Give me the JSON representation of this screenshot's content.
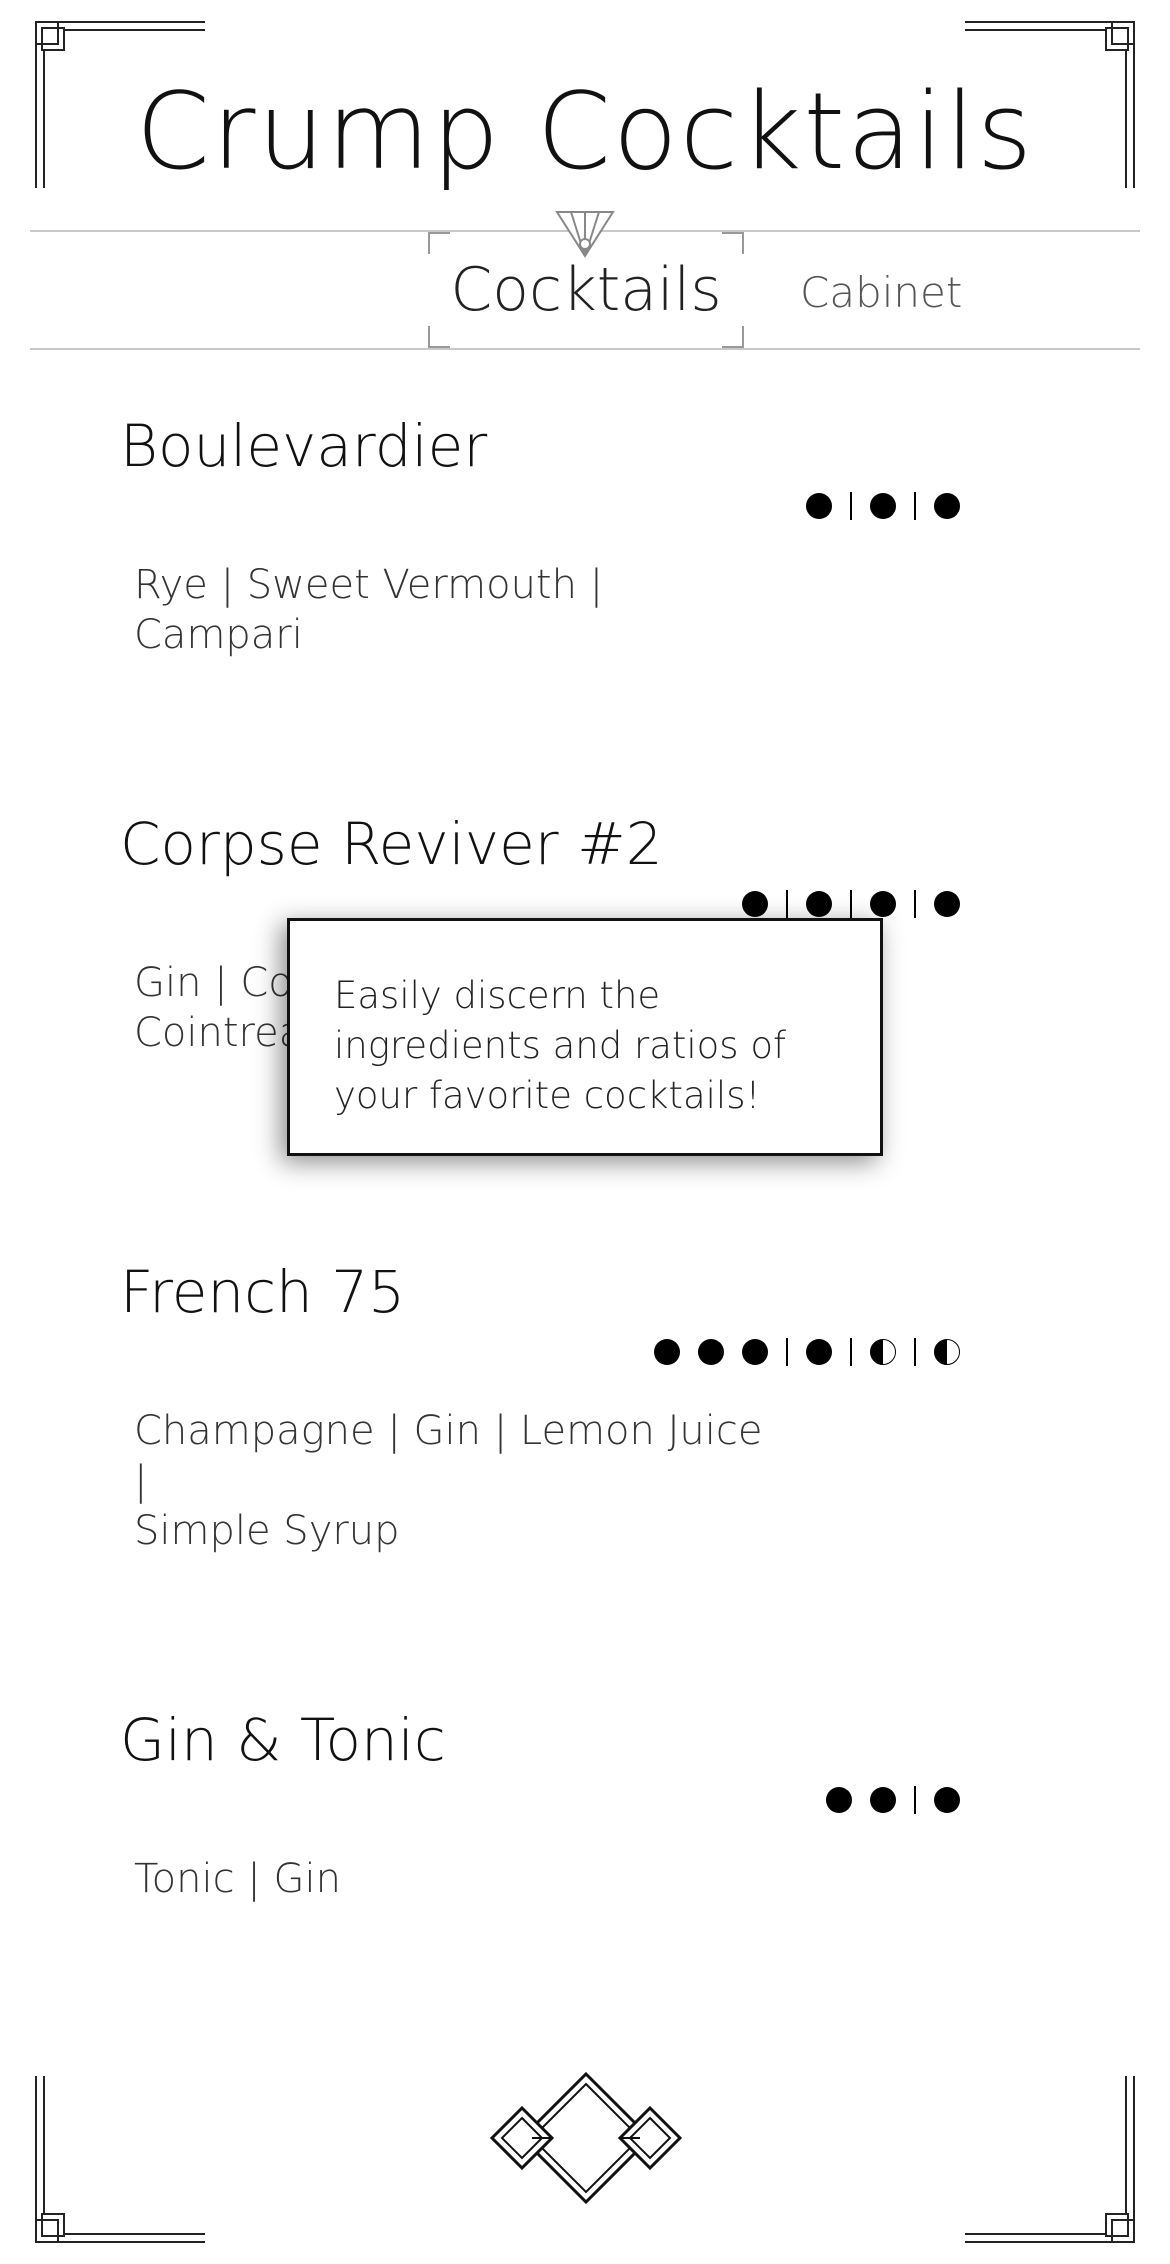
{
  "app": {
    "title": "Crump Cocktails"
  },
  "nav": {
    "tabs": [
      {
        "label": "Cocktails",
        "active": true
      },
      {
        "label": "Cabinet",
        "active": false
      }
    ]
  },
  "cocktails": [
    {
      "name": "Boulevardier",
      "ingredients": "Rye | Sweet Vermouth | Campari",
      "ratio": [
        "full",
        "sep",
        "full",
        "sep",
        "full"
      ]
    },
    {
      "name": "Corpse Reviver #2",
      "ingredients": "Gin | Cocchi Americano | Lemon Juice | Cointreau",
      "ingredients_line1": "Gin | Co",
      "ingredients_line2": "Cointrea",
      "ratio": [
        "full",
        "sep",
        "full",
        "sep",
        "full",
        "sep",
        "full"
      ]
    },
    {
      "name": "French 75",
      "ingredients": "Champagne | Gin | Lemon Juice | Simple Syrup",
      "ingredients_line1": "Champagne | Gin | Lemon Juice |",
      "ingredients_line2": "Simple Syrup",
      "ratio": [
        "full",
        "full",
        "full",
        "sep",
        "full",
        "sep",
        "half",
        "sep",
        "half"
      ]
    },
    {
      "name": "Gin & Tonic",
      "ingredients": "Tonic | Gin",
      "ratio": [
        "full",
        "full",
        "sep",
        "full"
      ]
    }
  ],
  "tooltip": {
    "text": "Easily discern the ingredients and ratios of your favorite cocktails!"
  },
  "icons": {
    "corners": "art-deco-corner-icon",
    "nav_emblem": "art-deco-fan-icon",
    "footer": "interlocking-diamonds-icon"
  },
  "colors": {
    "text": "#111111",
    "muted": "#555555",
    "rule": "#c8c8c8",
    "background": "#ffffff"
  }
}
